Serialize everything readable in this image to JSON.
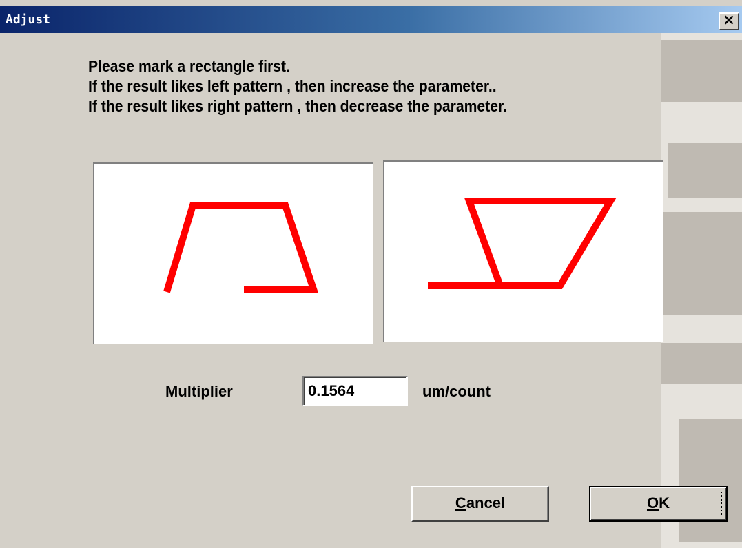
{
  "window": {
    "title": "Adjust",
    "close_symbol": "×"
  },
  "instructions": [
    "Please mark a rectangle first.",
    "If the result likes left pattern , then increase the parameter..",
    "If the result likes right pattern , then decrease the parameter."
  ],
  "patterns": {
    "left_name": "left-pattern",
    "right_name": "right-pattern",
    "stroke_color": "#ff0000"
  },
  "multiplier": {
    "label": "Multiplier",
    "value": "0.1564",
    "unit": "um/count"
  },
  "buttons": {
    "cancel_mnemonic": "C",
    "cancel_rest": "ancel",
    "ok_mnemonic": "O",
    "ok_rest": "K"
  },
  "icons": {
    "close": "close-icon"
  }
}
